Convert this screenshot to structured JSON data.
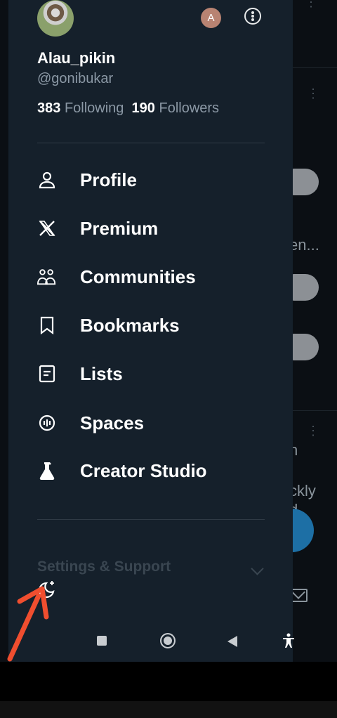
{
  "profile": {
    "display_name": "Alau_pikin",
    "handle": "@gonibukar",
    "following_count": "383",
    "following_label": "Following",
    "followers_count": "190",
    "followers_label": "Followers",
    "switch_account_initial": "A"
  },
  "menu": [
    {
      "label": "Profile",
      "icon": "person-icon"
    },
    {
      "label": "Premium",
      "icon": "x-logo-icon"
    },
    {
      "label": "Communities",
      "icon": "communities-icon"
    },
    {
      "label": "Bookmarks",
      "icon": "bookmark-icon"
    },
    {
      "label": "Lists",
      "icon": "list-icon"
    },
    {
      "label": "Spaces",
      "icon": "spaces-icon"
    },
    {
      "label": "Creator Studio",
      "icon": "flask-icon"
    }
  ],
  "settings_label": "Settings & Support",
  "background": {
    "snippet_1": "en...",
    "snippet_2": "n",
    "snippet_3": "ckly",
    "snippet_4": "d"
  },
  "colors": {
    "drawer_bg": "#15202b",
    "annotation_arrow": "#f04e2f",
    "fab": "#1d6fa5"
  }
}
